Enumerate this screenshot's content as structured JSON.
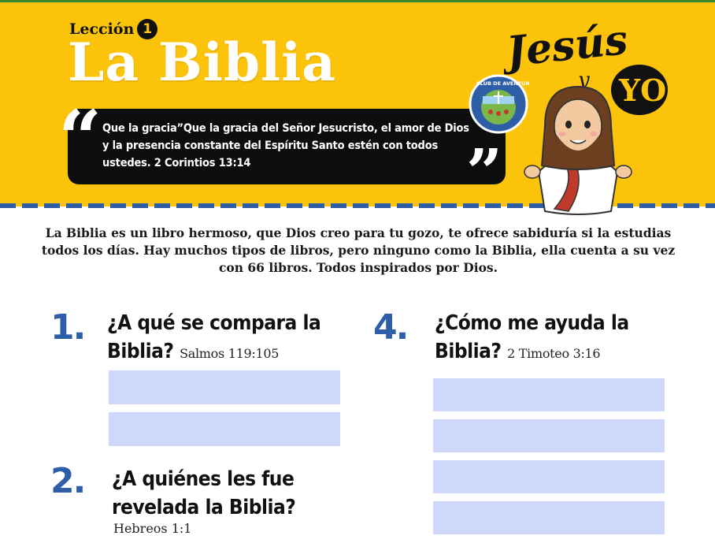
{
  "header": {
    "lesson_word": "Lección",
    "lesson_number": "1",
    "title": "La Biblia",
    "quote_open": "“",
    "quote_close": "”",
    "quote_text": "Que la gracia”Que la gracia del Señor Jesucristo, el amor de Dios y la presencia constante del Espíritu Santo estén con todos ustedes.  2 Corintios 13:14",
    "brand_word_1": "Jesús",
    "brand_conj": "y",
    "brand_word_2": "YO",
    "badge_text": "CLUB DE AVENTUREROS"
  },
  "colors": {
    "header_bg": "#fcc30b",
    "accent_blue": "#2f5ea8",
    "answer_fill": "#cfd8fb"
  },
  "intro": "La Biblia es un libro hermoso, que Dios creo para tu gozo, te ofrece sabiduría si la estudias todos los días. Hay muchos tipos de libros, pero ninguno como la Biblia, ella cuenta a su vez con 66 libros. Todos inspirados por Dios.",
  "questions": [
    {
      "number": "1.",
      "line1": "¿A qué se compara la",
      "line2": "Biblia?",
      "ref": "Salmos 119:105"
    },
    {
      "number": "2.",
      "line1": "¿A quiénes les fue",
      "line2": "revelada la Biblia?",
      "ref": "Hebreos 1:1"
    },
    {
      "number": "4.",
      "line1": "¿Cómo me ayuda la",
      "line2": "Biblia?",
      "ref": "2 Timoteo 3:16"
    }
  ]
}
